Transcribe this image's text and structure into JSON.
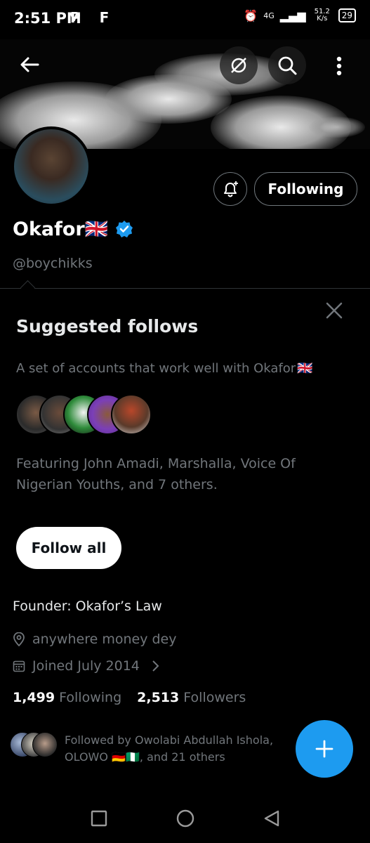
{
  "status_bar": {
    "time": "2:51 PM",
    "left_icons": "P F",
    "network": "4G",
    "speed": "51.2 K/s",
    "battery": "29"
  },
  "header": {
    "back_icon": "arrow-left-icon",
    "more_icon": "more-vertical-icon"
  },
  "profile": {
    "name": "Okafor",
    "name_flag": "🇬🇧",
    "handle": "@boychikks",
    "following_label": "Following",
    "bio": "Founder: Okafor’s Law",
    "location": "anywhere money dey",
    "joined": "Joined July 2014",
    "following_count": "1,499",
    "following_label_text": "Following",
    "followers_count": "2,513",
    "followers_label_text": "Followers"
  },
  "suggested": {
    "title": "Suggested follows",
    "subtitle": "A set of accounts that work well with Okafor",
    "subtitle_flag": "🇬🇧",
    "featuring": "Featuring John Amadi, Marshalla, Voice Of Nigerian Youths, and 7 others.",
    "follow_all_label": "Follow all"
  },
  "followed_by": {
    "line1": "Followed by Owolabi Abdullah Ishola,",
    "line2_prefix": "OLOWO",
    "line2_flags": "🇩🇪🇳🇬",
    "line2_suffix": ", and 21 others"
  },
  "colors": {
    "accent": "#1d9bf0",
    "muted": "#71767b",
    "background": "#000000"
  }
}
